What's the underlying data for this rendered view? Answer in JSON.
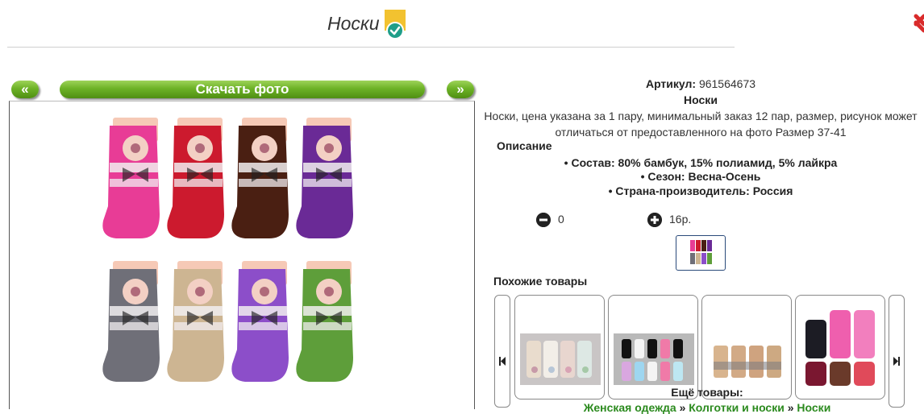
{
  "header": {
    "title": "Носки"
  },
  "nav": {
    "prev_label": "«",
    "next_label": "»",
    "download_label": "Скачать фото"
  },
  "product": {
    "article_label": "Артикул:",
    "article_value": "961564673",
    "name": "Носки",
    "summary_line1": "Носки, цена указана за 1 пару, минимальный заказ 12 пар, размер, рисунок может",
    "summary_line2": "отличаться от предоставленного на фото Размер 37-41",
    "description_heading": "Описание",
    "specs": [
      "Состав: 80% бамбук, 15% полиамид, 5% лайкра",
      "Сезон: Весна-Осень",
      "Страна-производитель: Россия"
    ]
  },
  "quantity": {
    "value": "0",
    "unit": "16р."
  },
  "similar": {
    "heading": "Похожие товары"
  },
  "more": {
    "heading": "Ещё товары:",
    "breadcrumbs": [
      "Женская одежда",
      "Колготки и носки",
      "Носки"
    ],
    "separator": "»"
  },
  "colors": {
    "accent_green": "#6db227",
    "link_green": "#2b8a1e",
    "badge_yellow": "#f2c230",
    "badge_teal": "#1f9e89"
  },
  "sock_colors": [
    "#e83c96",
    "#cc1a2e",
    "#4a1f12",
    "#6a2a96",
    "#6f6f78",
    "#cdb592",
    "#8c4ec9",
    "#5e9e3a"
  ]
}
